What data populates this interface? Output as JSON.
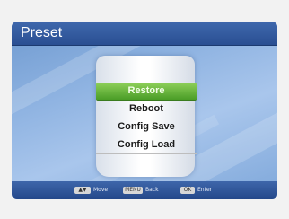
{
  "header": {
    "title": "Preset"
  },
  "menu": {
    "items": [
      {
        "label": "Restore",
        "selected": true
      },
      {
        "label": "Reboot",
        "selected": false
      },
      {
        "label": "Config Save",
        "selected": false
      },
      {
        "label": "Config Load",
        "selected": false
      }
    ]
  },
  "footer": {
    "hints": [
      {
        "key": "▲▼",
        "key_icon": "up-down-arrows-icon",
        "label": "Move"
      },
      {
        "key": "MENU",
        "key_icon": "menu-key-icon",
        "label": "Back"
      },
      {
        "key": "OK",
        "key_icon": "ok-key-icon",
        "label": "Enter"
      }
    ]
  },
  "colors": {
    "title_bar": "#2f5aa0",
    "selected_item": "#5faf34",
    "background": "#90b4e2"
  }
}
